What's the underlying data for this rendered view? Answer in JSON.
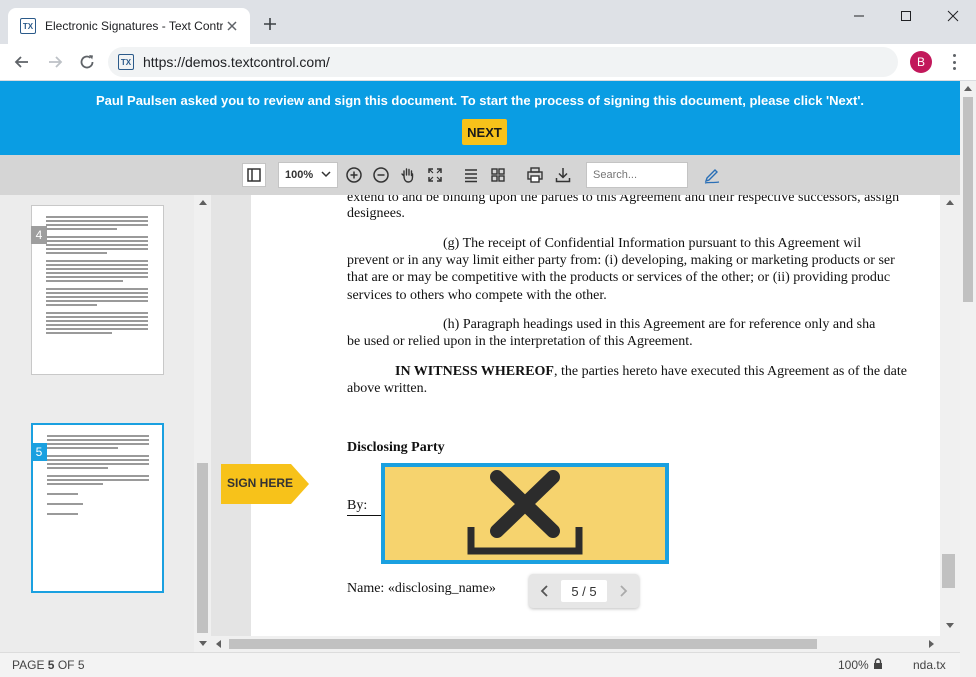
{
  "browser": {
    "tab_title": "Electronic Signatures - Text Control",
    "tab_favicon_text": "TX",
    "url": "https://demos.textcontrol.com/",
    "profile_initial": "B"
  },
  "banner": {
    "message": "Paul Paulsen asked you to review and sign this document. To start the process of signing this document, please click 'Next'.",
    "next_label": "NEXT"
  },
  "viewer_toolbar": {
    "zoom": "100%",
    "search_placeholder": "Search..."
  },
  "sidebar": {
    "thumbnails": [
      {
        "page": "4",
        "active": false
      },
      {
        "page": "5",
        "active": true
      }
    ]
  },
  "document": {
    "lines": [
      "extend to and be binding upon the parties to this Agreement and their respective successors, assign",
      "designees.",
      "(g)        The receipt of Confidential Information pursuant to this Agreement wil",
      "prevent or in any way limit either party from: (i) developing, making or marketing products or ser",
      "that are or may be competitive with the products or services of the other; or (ii) providing produc",
      "services to others who compete with the other.",
      "(h)        Paragraph headings used in this Agreement are for reference only and sha",
      "be used or relied upon in the interpretation of this Agreement."
    ],
    "witness_bold": "IN WITNESS WHEREOF",
    "witness_rest": ", the parties hereto have executed this Agreement as of the date",
    "witness_line2": "above written.",
    "disclosing_heading": "Disclosing Party",
    "by_label": "By:",
    "name_label": "Name: «disclosing_name»",
    "sign_here_label": "SIGN HERE"
  },
  "pager": {
    "value": "5 / 5"
  },
  "status": {
    "page_prefix": "PAGE ",
    "page_current": "5",
    "page_suffix": " OF 5",
    "zoom": "100%",
    "filename": "nda.tx"
  },
  "colors": {
    "banner": "#0a9de3",
    "next_button": "#f7c21a",
    "signature_box": "#f6d36e",
    "signature_border": "#1aa0e0"
  }
}
